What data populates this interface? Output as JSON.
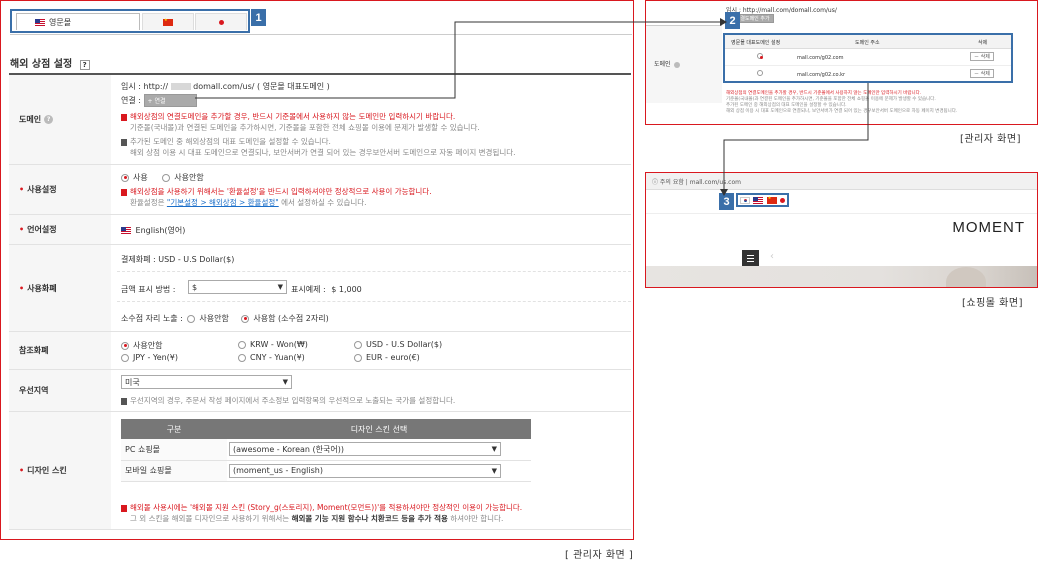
{
  "admin": {
    "tabs": [
      {
        "label": "영문몰",
        "flag": "us"
      },
      {
        "label": "",
        "flag": "cn"
      },
      {
        "label": "",
        "flag": "jp"
      }
    ],
    "section_title": "해외 상점 설정",
    "help_icon_label": "?",
    "rows": {
      "domain": {
        "label": "도메인",
        "temp_line": "임시 : http://",
        "temp_url_blur": "domall.com/us/ ( 영문몰 대표도메인 )",
        "connect_label": "연결 :",
        "connect_btn": "+ 연결",
        "notes": [
          {
            "text": "해외상점의 연결도메인을 추가할 경우, 반드시 기준몰에서 사용하지 않는 도메인만 입력하시기 바랍니다.",
            "red": true
          },
          {
            "text": "기준몰(국내몰)과 연결된 도메인을 추가하시면, 기준몰을 포함한 전체 쇼핑몰 이용에 문제가 발생할 수 있습니다.",
            "red": false
          },
          {
            "text": "추가된 도메인 중 해외상점의 대표 도메인을 설정할 수 있습니다.",
            "red": false
          },
          {
            "text": "해외 상점 이용 시 대표 도메인으로 연결되나, 보안서버가 연결 되어 있는 경우보안서버 도메인으로 자동 페이지 변경됩니다.",
            "red": false
          }
        ]
      },
      "usage": {
        "label": "사용설정",
        "opt_on": "사용",
        "opt_off": "사용안함",
        "note_red": "해외상점을 사용하기 위해서는 '환율설정'을 반드시 입력하셔야만 정상적으로 사용이 가능합니다.",
        "note_prefix": "환율설정은 ",
        "note_link": "\"기본설정 > 해외상점 > 환율설정\"",
        "note_suffix": " 에서 설정하실 수 있습니다."
      },
      "language": {
        "label": "언어설정",
        "value": "English(영어)"
      },
      "currency": {
        "label": "사용화폐",
        "payment": "결제화폐 : USD - U.S Dollar($)",
        "display_label": "금액 표시 방법 :",
        "display_value": "$",
        "example_label": "표시예제 :",
        "example_value": "$  1,000",
        "decimal_label": "소수점 자리 노출 :",
        "decimal_off": "사용안함",
        "decimal_on": "사용함 (소수점 2자리)"
      },
      "reference": {
        "label": "참조화폐",
        "options": [
          "사용안함",
          "KRW - Won(₩)",
          "USD - U.S Dollar($)",
          "JPY - Yen(¥)",
          "CNY - Yuan(¥)",
          "EUR - euro(€)"
        ]
      },
      "region": {
        "label": "우선지역",
        "value": "미국",
        "note": "우선지역의 경우, 주문서 작성 페이지에서 주소정보 입력항목의 우선적으로 노출되는 국가를 설정합니다."
      },
      "skin": {
        "label": "디자인 스킨",
        "col1": "구분",
        "col2": "디자인 스킨 선택",
        "pc_label": "PC 쇼핑몰",
        "pc_value": "(awesome - Korean (한국어))",
        "mobile_label": "모바일 쇼핑몰",
        "mobile_value": "(moment_us - English)",
        "note_red": "해외몰 사용시에는 '해외몰 지원 스킨 (Story_g(스토리지), Moment(모먼트))'를 적용하셔야만 정상적인 이용이 가능합니다.",
        "note_prefix": "그 외 스킨을 해외몰 디자인으로 사용하기 위해서는 ",
        "note_bold": "해외몰 기능 지원 함수나 치환코드 등을 추가 적용",
        "note_suffix": " 하셔야만 합니다."
      }
    },
    "caption": "[ 관리자 화면 ]"
  },
  "admin_small": {
    "temp": "임시 : http://mall.com/domall.com/us/",
    "add_btn": "+ 연결도메인 추가",
    "label": "도메인",
    "col1": "영문몰 대표도메인 설정",
    "col2": "도메인 주소",
    "col3": "삭제",
    "rows": [
      {
        "domain": "mall.com/g02.com",
        "btn": "－ 삭제",
        "selected": true
      },
      {
        "domain": "mall.com/g02.co.kr",
        "btn": "－ 삭제",
        "selected": false
      }
    ],
    "notes": [
      "해외상점의 연결도메인을 추가할 경우, 반드시 기준몰에서 사용하지 않는 도메인만 입력하시기 바랍니다.",
      "기준몰(국내몰)과 연결된 도메인을 추가하시면, 기준몰을 포함한 전체 쇼핑몰 이용에 문제가 발생할 수 있습니다.",
      "추가된 도메인 중 해외상점의 대표 도메인을 설정할 수 있습니다.",
      "해외 상점 이용 시 대표 도메인으로 연결되나, 보안서버가 연결 되어 있는 경우보안서버 도메인으로 자동 페이지 변경됩니다."
    ],
    "caption": "[관리자 화면]"
  },
  "shop": {
    "address_bar": "ⓘ 주의 요함 | mall.com/us.com",
    "brand": "MOMENT",
    "caption": "[쇼핑몰 화면]"
  },
  "markers": [
    "1",
    "2",
    "3"
  ]
}
